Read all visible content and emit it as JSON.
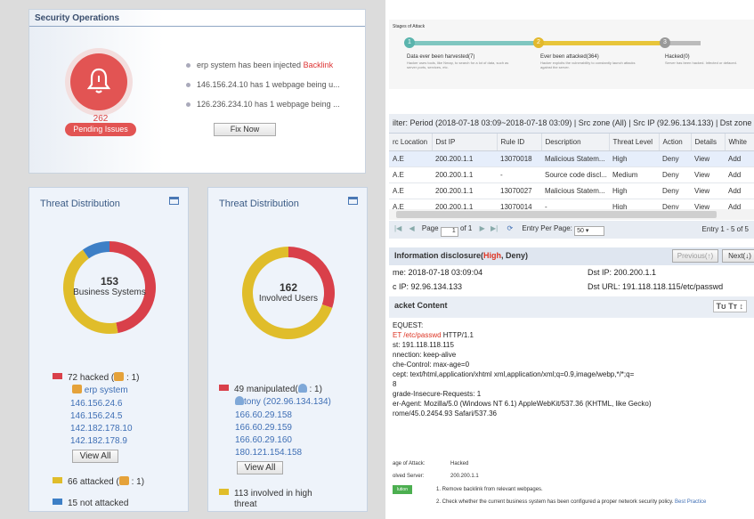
{
  "secops": {
    "title": "Security Operations",
    "pending_count": "262",
    "pending_label": "Pending Issues",
    "events": [
      {
        "text": "erp system has been injected ",
        "highlight": "Backlink"
      },
      {
        "text": "146.156.24.10 has 1 webpage being u..."
      },
      {
        "text": "126.236.234.10 has 1 webpage being ..."
      }
    ],
    "fix_button": "Fix Now",
    "colors": {
      "alert": "#e25453"
    }
  },
  "threat_left": {
    "title": "Threat Distribution",
    "center_count": "153",
    "center_label": "Business Systems",
    "hacked_label": "72 hacked (",
    "hacked_suffix": " : 1)",
    "system_name": "erp system",
    "ips": [
      "146.156.24.6",
      "146.156.24.5",
      "142.182.178.10",
      "142.182.178.9"
    ],
    "view_all": "View All",
    "attacked_label": "66 attacked (",
    "attacked_suffix": " : 1)",
    "not_attacked_label": "15 not attacked"
  },
  "threat_right": {
    "title": "Threat Distribution",
    "center_count": "162",
    "center_label": "Involved Users",
    "manip_label": "49 manipulated(",
    "manip_suffix": " : 1)",
    "user_name": "tony (202.96.134.134)",
    "ips": [
      "166.60.29.158",
      "166.60.29.159",
      "166.60.29.160",
      "180.121.154.158"
    ],
    "view_all": "View All",
    "high_label": "113 involved in high",
    "high_label2": "threat"
  },
  "donut_colors": {
    "red": "#d9404a",
    "yellow": "#e0bd2a",
    "blue": "#3d7fc6"
  },
  "donut_left": {
    "red": 72,
    "yellow": 66,
    "blue": 15
  },
  "donut_right": {
    "red": 49,
    "yellow": 113
  },
  "stages": {
    "title": "Stages of Attack",
    "s1_num": "1",
    "s1": "Data ever been harvested(7)",
    "s1_sub": "Hacker uses tools, like Nmap, to search for a lot of data, such as server ports, services, etc.",
    "s2_num": "2",
    "s2": "Ever been attacked(364)",
    "s2_sub": "Hacker exploits the vulnerability to constantly launch attacks against the server.",
    "s3_num": "3",
    "s3": "Hacked(0)",
    "s3_sub": "Server has been hacked. Infected or defaced."
  },
  "filter": "ilter: Period (2018-07-18 03:09~2018-07-18 03:09) | Src zone (All) | Src IP (92.96.134.133) | Dst zone (All) | Dst",
  "grid": {
    "headers": [
      "rc Location",
      "Dst IP",
      "Rule ID",
      "Description",
      "Threat Level",
      "Action",
      "Details",
      "White"
    ],
    "rows": [
      [
        "A.E",
        "200.200.1.1",
        "13070018",
        "Malicious Statem...",
        "High",
        "Deny",
        "View",
        "Add"
      ],
      [
        "A.E",
        "200.200.1.1",
        "-",
        "Source code discl...",
        "Medium",
        "Deny",
        "View",
        "Add"
      ],
      [
        "A.E",
        "200.200.1.1",
        "13070027",
        "Malicious Statem...",
        "High",
        "Deny",
        "View",
        "Add"
      ],
      [
        "A.E",
        "200.200.1.1",
        "13070014",
        "-",
        "High",
        "Deny",
        "View",
        "Add"
      ]
    ]
  },
  "pager": {
    "page_label": "Page",
    "page": "1",
    "of": "of 1",
    "per_page_label": "Entry Per Page:",
    "per_page": "50",
    "entries": "Entry 1 - 5 of 5"
  },
  "detail": {
    "title_a": "Information disclosure(",
    "title_hi": "High",
    "title_b": ", Deny)",
    "prev": "Previous(↑)",
    "next": "Next(↓)",
    "time": "me: 2018-07-18 03:09:04",
    "src": "c IP: 92.96.134.133",
    "dst_ip": "Dst IP: 200.200.1.1",
    "dst_url": "Dst URL: 191.118.118.115/etc/passwd",
    "packet_title": "acket Content",
    "tools": "Tʊ  Tт  ↕"
  },
  "packet": {
    "l1": "EQUEST:",
    "l2_red": "ET /etc/passwd",
    "l2": " HTTP/1.1",
    "l3": "st: 191.118.118.115",
    "l4": "nnection: keep-alive",
    "l5": "che-Control: max-age=0",
    "l6": "cept: text/html,application/xhtml xml,application/xml;q=0.9,image/webp,*/*;q=",
    "l7": "8",
    "l8": "grade-Insecure-Requests: 1",
    "l9": "er-Agent: Mozilla/5.0 (Windows NT 6.1) AppleWebKit/537.36 (KHTML, like Gecko)",
    "l10": "rome/45.0.2454.93 Safari/537.36"
  },
  "bottom": {
    "stage_label": "age of Attack:",
    "stage_val": "Hacked",
    "server_label": "olved Server:",
    "server_val": "200.200.1.1",
    "sol_btn": "lution",
    "step1": "1. Remove backlink from relevant webpages.",
    "step2": "2. Check whether the current business system has been configured a proper network security policy.",
    "best": "Best Practice"
  }
}
